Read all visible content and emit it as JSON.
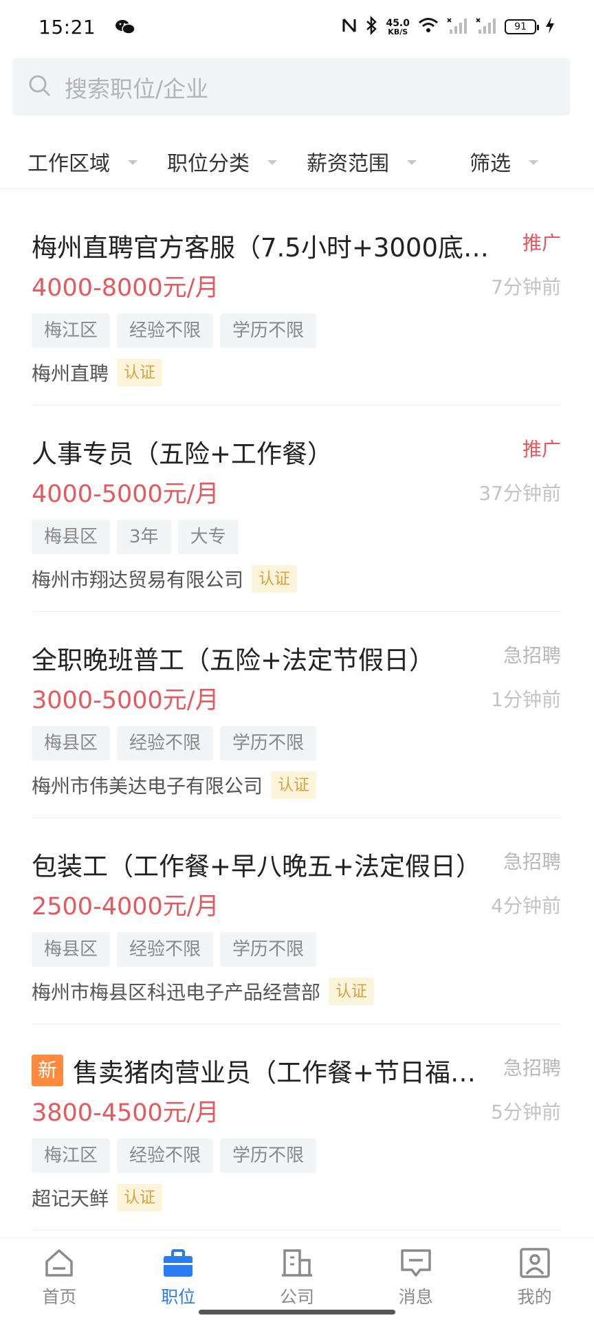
{
  "status_bar": {
    "time": "15:21",
    "net_speed_value": "45.0",
    "net_speed_unit": "KB/S",
    "battery": "91"
  },
  "search": {
    "placeholder": "搜索职位/企业"
  },
  "filters": [
    {
      "label": "工作区域"
    },
    {
      "label": "职位分类"
    },
    {
      "label": "薪资范围"
    },
    {
      "label": "筛选"
    }
  ],
  "jobs": [
    {
      "title": "梅州直聘官方客服（7.5小时+3000底薪…",
      "tag": "推广",
      "tag_color": "#e8575b",
      "salary": "4000-8000元/月",
      "time": "7分钟前",
      "chips": [
        "梅江区",
        "经验不限",
        "学历不限"
      ],
      "company": "梅州直聘",
      "verify": "认证",
      "is_new": false
    },
    {
      "title": "人事专员（五险+工作餐）",
      "tag": "推广",
      "tag_color": "#e8575b",
      "salary": "4000-5000元/月",
      "time": "37分钟前",
      "chips": [
        "梅县区",
        "3年",
        "大专"
      ],
      "company": "梅州市翔达贸易有限公司",
      "verify": "认证",
      "is_new": false
    },
    {
      "title": "全职晚班普工（五险+法定节假日）",
      "tag": "急招聘",
      "tag_color": "#b8b8b8",
      "salary": "3000-5000元/月",
      "time": "1分钟前",
      "chips": [
        "梅县区",
        "经验不限",
        "学历不限"
      ],
      "company": "梅州市伟美达电子有限公司",
      "verify": "认证",
      "is_new": false
    },
    {
      "title": "包装工（工作餐+早八晚五+法定假日）",
      "tag": "急招聘",
      "tag_color": "#b8b8b8",
      "salary": "2500-4000元/月",
      "time": "4分钟前",
      "chips": [
        "梅县区",
        "经验不限",
        "学历不限"
      ],
      "company": "梅州市梅县区科迅电子产品经营部",
      "verify": "认证",
      "is_new": false
    },
    {
      "title": "售卖猪肉营业员（工作餐+节日福…",
      "tag": "急招聘",
      "tag_color": "#b8b8b8",
      "salary": "3800-4500元/月",
      "time": "5分钟前",
      "chips": [
        "梅江区",
        "经验不限",
        "学历不限"
      ],
      "company": "超记天鲜",
      "verify": "认证",
      "is_new": true,
      "new_label": "新"
    }
  ],
  "bottom_nav": [
    {
      "label": "首页",
      "icon": "home-icon",
      "active": false
    },
    {
      "label": "职位",
      "icon": "briefcase-icon",
      "active": true
    },
    {
      "label": "公司",
      "icon": "building-icon",
      "active": false
    },
    {
      "label": "消息",
      "icon": "message-icon",
      "active": false
    },
    {
      "label": "我的",
      "icon": "profile-icon",
      "active": false
    }
  ],
  "colors": {
    "accent": "#2a7cf4",
    "salary": "#e8575b",
    "promo": "#e8575b",
    "urgent": "#b8b8b8",
    "verify_bg": "#fdf4dc",
    "verify_text": "#d9a23e",
    "new_badge": "#ff8a3d"
  }
}
